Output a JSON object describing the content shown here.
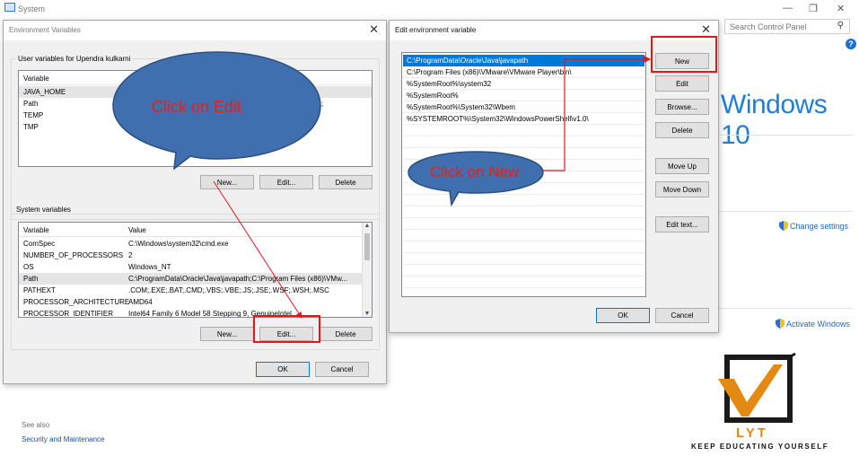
{
  "system_window": {
    "title": "System",
    "search_placeholder": "Search Control Panel",
    "help": "?",
    "windows_brand": "Windows 10",
    "change_settings": "Change settings",
    "activate_windows": "Activate Windows",
    "see_also": "See also",
    "security_and_maintenance": "Security and Maintenance"
  },
  "env_dialog": {
    "title": "Environment Variables",
    "close": "✕",
    "user_group_label": "User variables for Upendra kulkarni",
    "user_columns": [
      "Variable",
      "Value"
    ],
    "user_rows": [
      {
        "variable": "JAVA_HOME",
        "value": ""
      },
      {
        "variable": "Path",
        "value": ""
      },
      {
        "variable": "TEMP",
        "value": ""
      },
      {
        "variable": "TMP",
        "value": ""
      }
    ],
    "user_buttons": {
      "new": "New...",
      "edit": "Edit...",
      "delete": "Delete"
    },
    "system_group_label": "System variables",
    "system_columns": [
      "Variable",
      "Value"
    ],
    "system_rows": [
      {
        "variable": "ComSpec",
        "value": "C:\\Windows\\system32\\cmd.exe"
      },
      {
        "variable": "NUMBER_OF_PROCESSORS",
        "value": "2"
      },
      {
        "variable": "OS",
        "value": "Windows_NT"
      },
      {
        "variable": "Path",
        "value": "C:\\ProgramData\\Oracle\\Java\\javapath;C:\\Program Files (x86)\\VMw..."
      },
      {
        "variable": "PATHEXT",
        "value": ".COM;.EXE;.BAT;.CMD;.VBS;.VBE;.JS;.JSE;.WSF;.WSH;.MSC"
      },
      {
        "variable": "PROCESSOR_ARCHITECTURE",
        "value": "AMD64"
      },
      {
        "variable": "PROCESSOR_IDENTIFIER",
        "value": "Intel64 Family 6 Model 58 Stepping 9, GenuineIntel"
      }
    ],
    "system_buttons": {
      "new": "New...",
      "edit": "Edit...",
      "delete": "Delete"
    },
    "ok": "OK",
    "cancel": "Cancel"
  },
  "edit_dialog": {
    "title": "Edit environment variable",
    "close": "✕",
    "entries": [
      "C:\\ProgramData\\Oracle\\Java\\javapath",
      "C:\\Program Files (x86)\\VMware\\VMware Player\\bin\\",
      "%SystemRoot%\\system32",
      "%SystemRoot%",
      "%SystemRoot%\\System32\\Wbem",
      "%SYSTEMROOT%\\System32\\WindowsPowerShell\\v1.0\\"
    ],
    "selected_index": 0,
    "buttons": {
      "new": "New",
      "edit": "Edit",
      "browse": "Browse...",
      "delete": "Delete",
      "move_up": "Move Up",
      "move_down": "Move Down",
      "edit_text": "Edit text..."
    },
    "ok": "OK",
    "cancel": "Cancel"
  },
  "annotations": {
    "click_on_edit": "Click on Edit",
    "click_on_new": "Click on New",
    "highlight_color": "#e3161b",
    "bubble_fill": "#3f6fae",
    "bubble_text_color": "#e32219"
  },
  "logo": {
    "text": "LYT",
    "tagline": "KEEP EDUCATING YOURSELF",
    "accent_color": "#e28a12"
  }
}
